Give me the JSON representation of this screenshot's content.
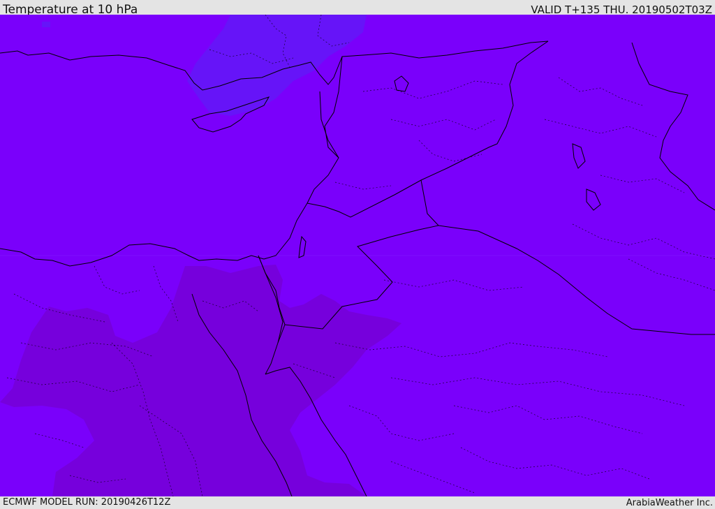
{
  "header": {
    "title": "Temperature at 10 hPa",
    "valid": "VALID T+135 THU. 20190502T03Z"
  },
  "footer": {
    "model_run": "ECMWF MODEL RUN: 20190426T12Z",
    "credit": "ArabiaWeather Inc."
  },
  "colors": {
    "base_field": "#7a00fb",
    "warm_field": "#7600dc",
    "cool_field": "#6614f8",
    "border_line": "#000000",
    "header_bg": "#e4e4e4"
  }
}
